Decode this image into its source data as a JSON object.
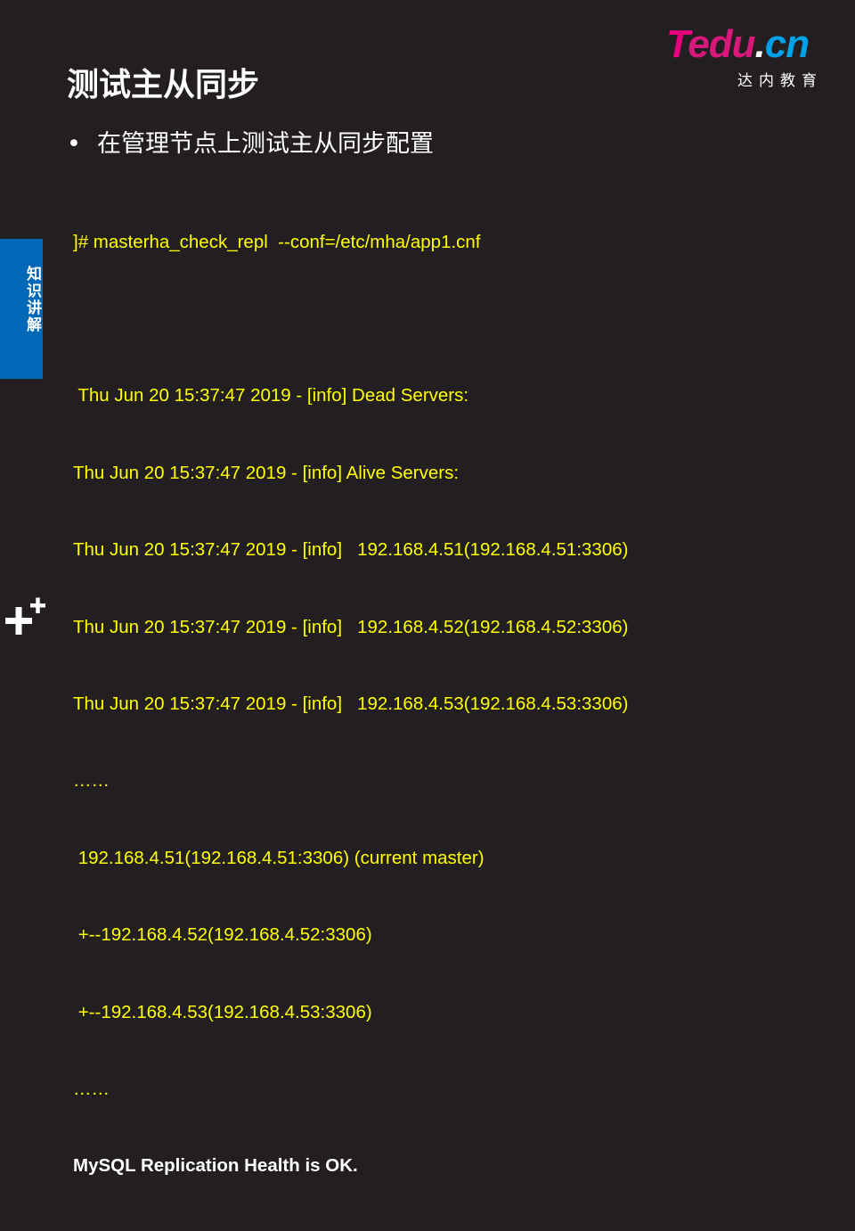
{
  "logo": {
    "brand_t": "T",
    "brand_edu": "edu",
    "brand_dot": ".",
    "brand_cn": "cn",
    "subtitle": "达内教育",
    "colors": {
      "t": "#e6007e",
      "edu": "#d6197a",
      "cn": "#00a0e9"
    }
  },
  "title": "测试主从同步",
  "bullet": {
    "symbol": "•",
    "text": "在管理节点上测试主从同步配置"
  },
  "side_tab": {
    "label": "知识讲解",
    "color": "#0068b7"
  },
  "console": {
    "text_color": "#ffff00",
    "lines": [
      "]# masterha_check_repl  --conf=/etc/mha/app1.cnf",
      "",
      " Thu Jun 20 15:37:47 2019 - [info] Dead Servers:",
      "Thu Jun 20 15:37:47 2019 - [info] Alive Servers:",
      "Thu Jun 20 15:37:47 2019 - [info]   192.168.4.51(192.168.4.51:3306)",
      "Thu Jun 20 15:37:47 2019 - [info]   192.168.4.52(192.168.4.52:3306)",
      "Thu Jun 20 15:37:47 2019 - [info]   192.168.4.53(192.168.4.53:3306)",
      "……",
      " 192.168.4.51(192.168.4.51:3306) (current master)",
      " +--192.168.4.52(192.168.4.52:3306)",
      " +--192.168.4.53(192.168.4.53:3306)",
      "……"
    ],
    "result_line": "MySQL Replication Health is OK."
  },
  "icons": {
    "corner": "plus-icon"
  }
}
